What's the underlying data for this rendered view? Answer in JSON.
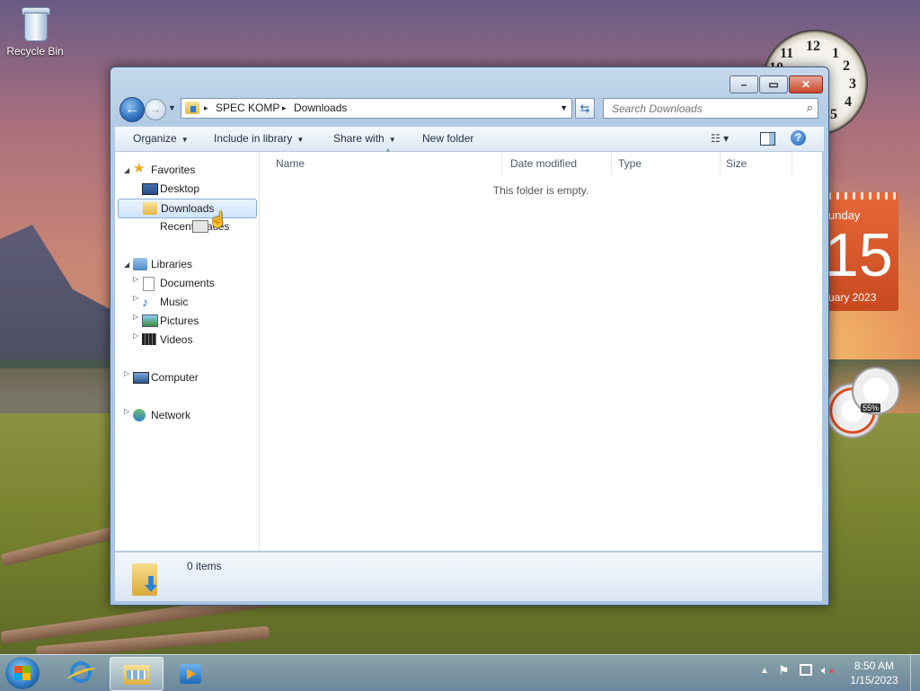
{
  "desktop": {
    "recycle_bin_label": "Recycle Bin",
    "clock_numbers": [
      "12",
      "1",
      "2",
      "3",
      "4",
      "5",
      "11",
      "10"
    ],
    "calendar": {
      "day": "unday",
      "date": "15",
      "month": "uary 2023"
    },
    "meter_percent": "55%"
  },
  "window": {
    "caption_buttons": {
      "minimize": "–",
      "maximize": "▭",
      "close": "✕"
    },
    "nav": {
      "back_glyph": "←",
      "forward_glyph": "→",
      "recent_glyph": "▼"
    },
    "address": {
      "separator": "▸",
      "crumbs": [
        "SPEC KOMP",
        "Downloads"
      ],
      "dropdown_glyph": "▼"
    },
    "refresh_glyph": "⇆",
    "search": {
      "placeholder": "Search Downloads",
      "icon": "search-icon"
    },
    "commands": {
      "organize": "Organize",
      "include_in_library": "Include in library",
      "share_with": "Share with",
      "new_folder": "New folder",
      "dropdown_glyph": "▼",
      "view_glyph": "☷ ▾",
      "help_glyph": "?"
    },
    "nav_pane": {
      "favorites": {
        "label": "Favorites",
        "items": [
          "Desktop",
          "Downloads",
          "Recent Places"
        ]
      },
      "libraries": {
        "label": "Libraries",
        "items": [
          "Documents",
          "Music",
          "Pictures",
          "Videos"
        ]
      },
      "computer": "Computer",
      "network": "Network"
    },
    "columns": [
      "Name",
      "Date modified",
      "Type",
      "Size"
    ],
    "empty_message": "This folder is empty.",
    "details": {
      "item_count": "0 items"
    }
  },
  "taskbar": {
    "time": "8:50 AM",
    "date": "1/15/2023",
    "pinned": [
      "Internet Explorer",
      "Windows Explorer",
      "Windows Media Player"
    ],
    "tray_icons": [
      "show-hidden-icons-icon",
      "action-center-flag-icon",
      "network-icon",
      "volume-muted-icon"
    ]
  }
}
